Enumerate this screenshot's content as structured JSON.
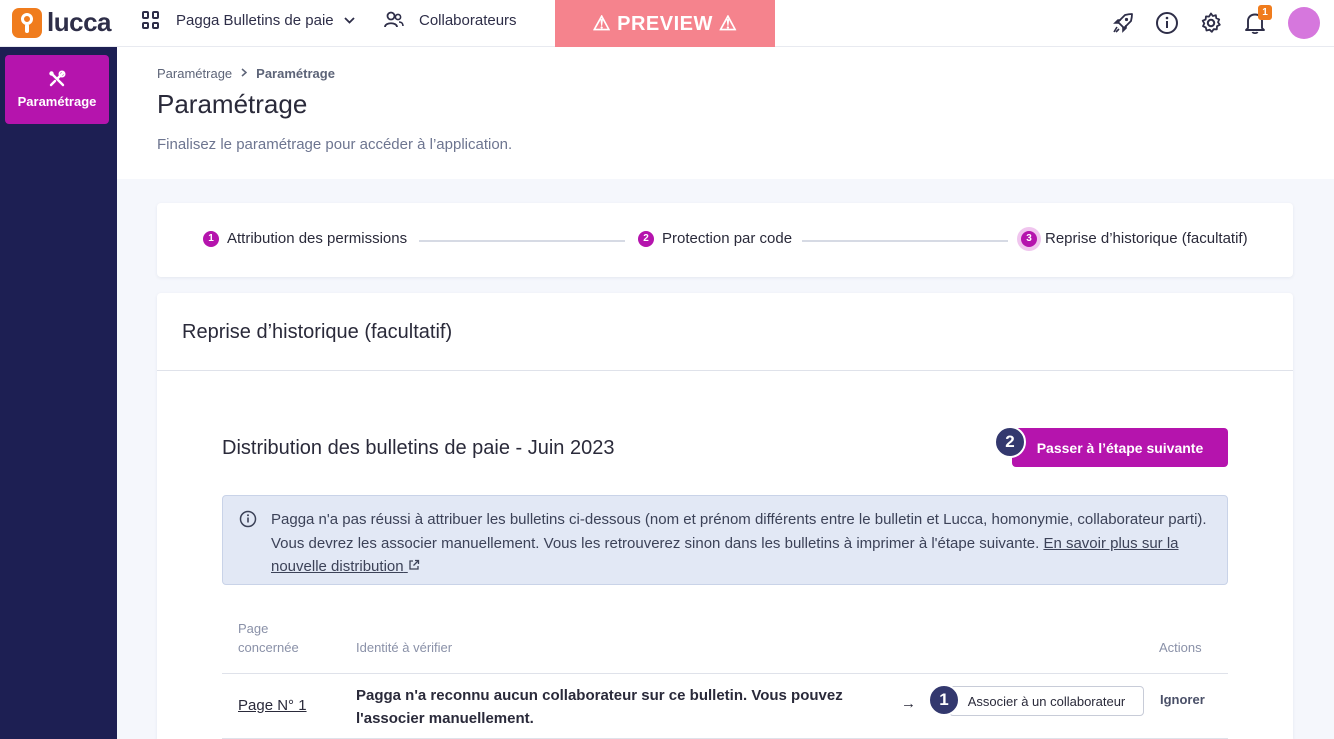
{
  "topbar": {
    "logo_text": "lucca",
    "app_name": "Pagga Bulletins de paie",
    "users_link": "Collaborateurs",
    "preview_label": "⚠ PREVIEW ⚠",
    "notification_count": "1",
    "icons": [
      "rocket-icon",
      "info-icon",
      "gear-icon",
      "bell-icon"
    ]
  },
  "sidebar": {
    "items": [
      {
        "label": "Paramétrage",
        "icon": "tools-icon"
      }
    ]
  },
  "header": {
    "breadcrumb": [
      "Paramétrage",
      "Paramétrage"
    ],
    "title": "Paramétrage",
    "subtitle": "Finalisez le paramétrage pour accéder à l’application."
  },
  "stepper": {
    "steps": [
      {
        "num": "1",
        "label": "Attribution des permissions"
      },
      {
        "num": "2",
        "label": "Protection par code"
      },
      {
        "num": "3",
        "label": "Reprise d’historique (facultatif)"
      }
    ]
  },
  "card": {
    "title": "Reprise d’historique (facultatif)",
    "section_title": "Distribution des bulletins de paie - Juin 2023",
    "next_button": "Passer à l’étape suivante",
    "alert": {
      "text": "Pagga n'a pas réussi à attribuer les bulletins ci-dessous (nom et prénom différents entre le bulletin et Lucca, homonymie, collaborateur parti). Vous devrez les associer manuellement. Vous les retrouverez sinon dans les bulletins à imprimer à l'étape suivante. ",
      "link": "En savoir plus sur la nouvelle distribution"
    },
    "table": {
      "headers": {
        "page": "Page concernée",
        "identity": "Identité à vérifier",
        "actions": "Actions"
      },
      "rows": [
        {
          "page": "Page N° 1",
          "message": "Pagga n'a reconnu aucun collaborateur sur ce bulletin. Vous pouvez l'associer manuellement.",
          "arrow": "→",
          "associate": "Associer à un collaborateur",
          "ignore": "Ignorer"
        }
      ]
    }
  },
  "callouts": [
    "2",
    "1"
  ],
  "colors": {
    "accent": "#b514ad",
    "sidebar": "#1d1f53",
    "preview": "#f5838d",
    "logo": "#f07c1d"
  }
}
